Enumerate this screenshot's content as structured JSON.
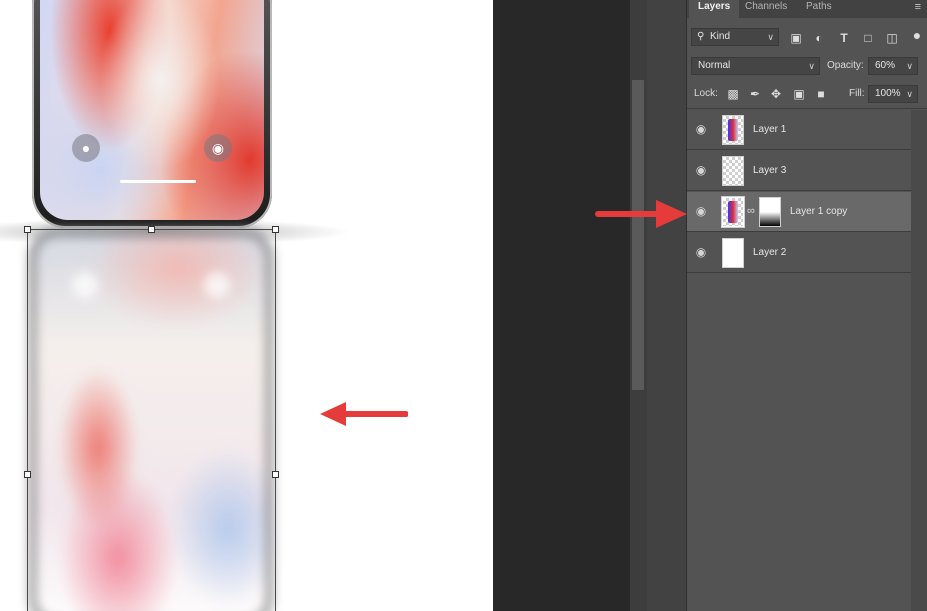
{
  "layers_panel": {
    "tabs": [
      {
        "label": "Layers",
        "active": true
      },
      {
        "label": "Channels",
        "active": false
      },
      {
        "label": "Paths",
        "active": false
      }
    ],
    "menu_icon": "hamburger-menu-icon",
    "filter": {
      "label": "Kind",
      "icon": "search-icon"
    },
    "filter_icons": [
      "image-filter-icon",
      "adjustment-filter-icon",
      "type-filter-icon",
      "shape-filter-icon",
      "smart-object-filter-icon",
      "filter-toggle-icon"
    ],
    "blend_mode": "Normal",
    "opacity_label": "Opacity:",
    "opacity_value": "60%",
    "lock_label": "Lock:",
    "lock_icons": [
      "lock-transparent-icon",
      "lock-image-icon",
      "lock-position-icon",
      "lock-artboard-icon",
      "lock-all-icon"
    ],
    "fill_label": "Fill:",
    "fill_value": "100%",
    "layers": [
      {
        "name": "Layer 1",
        "selected": false,
        "thumb": "phone"
      },
      {
        "name": "Layer 3",
        "selected": false,
        "thumb": "transparent"
      },
      {
        "name": "Layer 1 copy",
        "selected": true,
        "thumb": "phone",
        "has_mask": true
      },
      {
        "name": "Layer 2",
        "selected": false,
        "thumb": "white"
      }
    ]
  },
  "colors": {
    "arrow": "#e63b3b",
    "panel_bg": "#535353",
    "selected_layer": "#696969"
  }
}
